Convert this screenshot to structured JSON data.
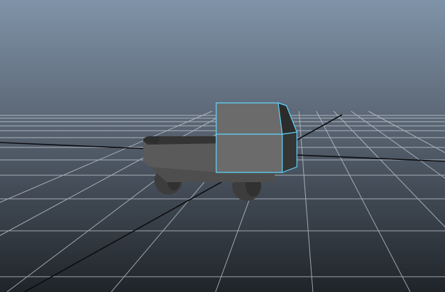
{
  "viewport": {
    "background_top_color": "#7f93a8",
    "horizon_color": "#5e6a79",
    "background_bottom_color": "#1f2429",
    "grid_line_color": "#c9ced6",
    "axis_line_color": "#0b0d10",
    "selection_color": "#5fd7ff",
    "object_color": "#6b6b6b"
  },
  "scene": {
    "object_name": "truck",
    "selection": "cab",
    "components": [
      "cab",
      "cargo-bed",
      "front-wheel",
      "rear-wheel"
    ]
  }
}
